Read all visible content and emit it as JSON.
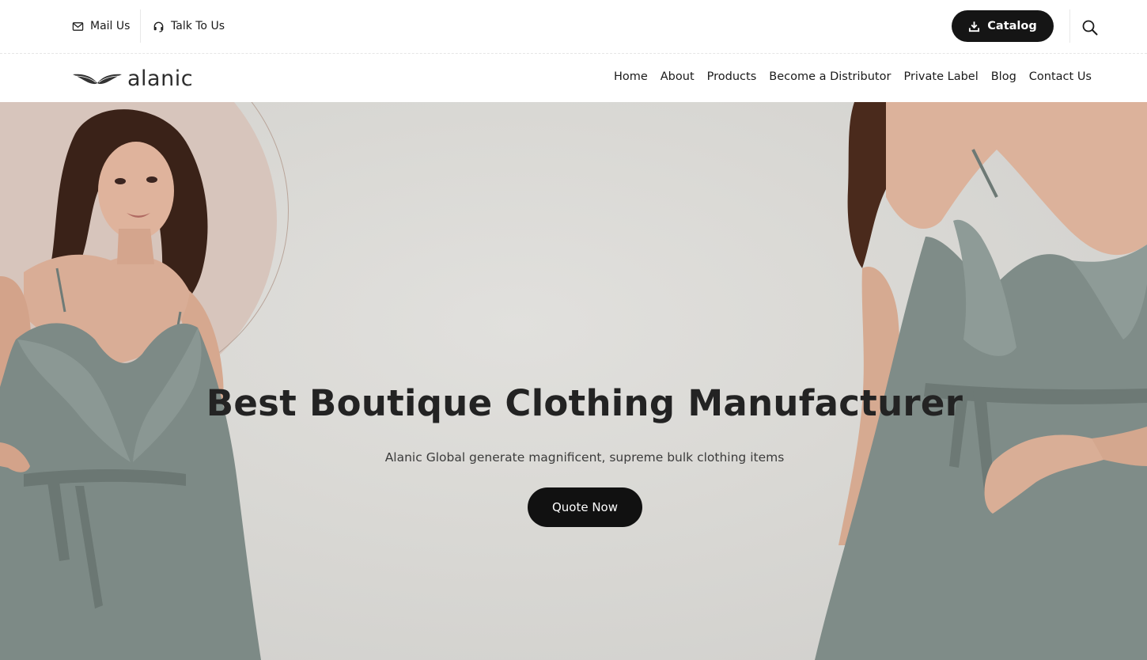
{
  "topbar": {
    "mail_label": "Mail Us",
    "talk_label": "Talk To Us",
    "catalog_label": "Catalog"
  },
  "logo": {
    "text": "alanic"
  },
  "nav": {
    "items": [
      "Home",
      "About",
      "Products",
      "Become a Distributor",
      "Private Label",
      "Blog",
      "Contact Us"
    ]
  },
  "hero": {
    "title": "Best Boutique Clothing Manufacturer",
    "subtitle": "Alanic Global generate magnificent, supreme bulk clothing items",
    "cta_label": "Quote Now"
  },
  "colors": {
    "button_bg": "#151515",
    "hero_bg": "#dcdbd7",
    "accent_circle": "#d7c5bc",
    "dress": "#7f8c88"
  },
  "icons": [
    "envelope-icon",
    "headset-icon",
    "download-icon",
    "search-icon",
    "wings-logo-icon"
  ]
}
